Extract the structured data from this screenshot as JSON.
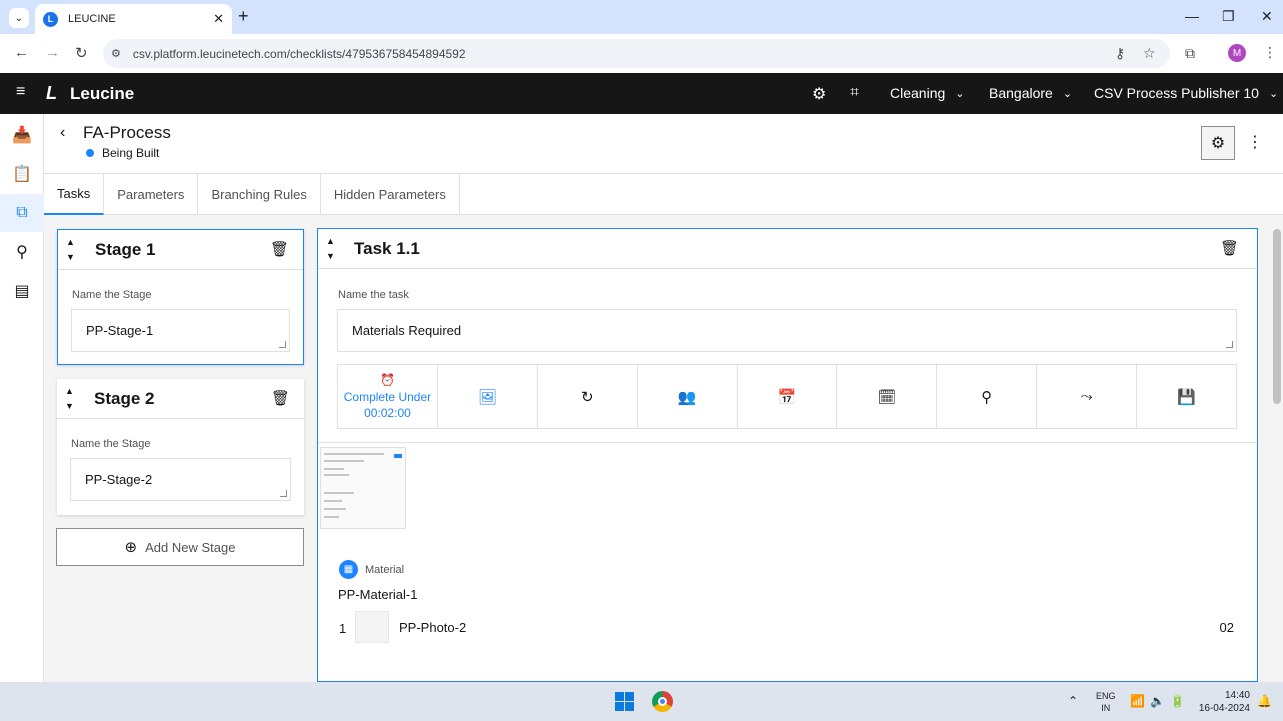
{
  "browser": {
    "tab_title": "LEUCINE",
    "favicon_letter": "L",
    "url": "csv.platform.leucinetech.com/checklists/479536758454894592",
    "profile_initial": "M"
  },
  "app": {
    "logo_mark": "L",
    "logo_text": "Leucine",
    "header": {
      "dropdowns": [
        "Cleaning",
        "Bangalore",
        "CSV Process Publisher 10"
      ]
    }
  },
  "process": {
    "title": "FA-Process",
    "status": "Being Built",
    "status_color": "#1d84ff"
  },
  "tabs": [
    "Tasks",
    "Parameters",
    "Branching Rules",
    "Hidden Parameters"
  ],
  "stages": [
    {
      "title": "Stage 1",
      "field_label": "Name the Stage",
      "value": "PP-Stage-1"
    },
    {
      "title": "Stage 2",
      "field_label": "Name the Stage",
      "value": "PP-Stage-2"
    }
  ],
  "add_stage_label": "Add New Stage",
  "task": {
    "title": "Task 1.1",
    "field_label": "Name the task",
    "value": "Materials Required",
    "timer_label_line1": "Complete Under",
    "timer_label_line2": "00:02:00",
    "material_label": "Material",
    "material_name": "PP-Material-1",
    "material_index": "1",
    "material_photo": "PP-Photo-2",
    "material_qty": "02"
  },
  "taskbar": {
    "lang_line1": "ENG",
    "lang_line2": "IN",
    "time": "14:40",
    "date": "16-04-2024"
  },
  "colors": {
    "accent": "#1d84ff",
    "header_bg": "#161616",
    "chrome_bg": "#d3e3fd"
  }
}
